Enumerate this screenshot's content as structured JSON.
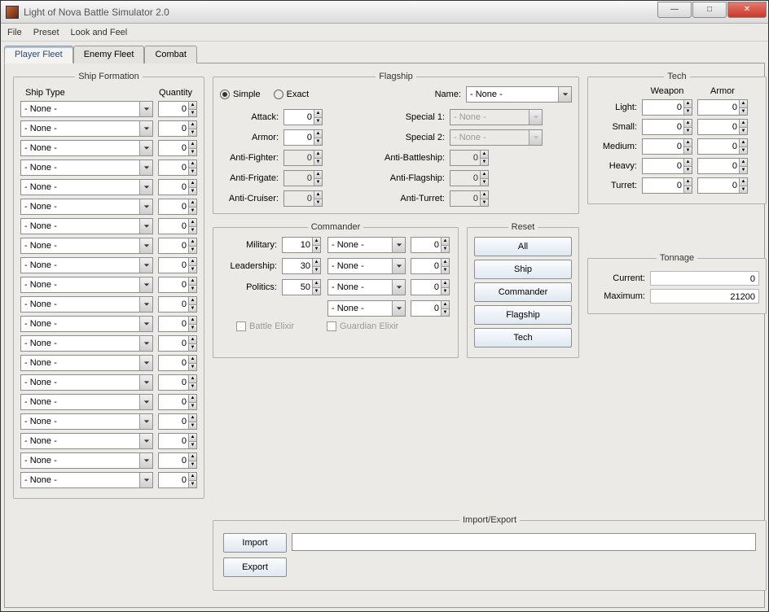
{
  "title": "Light of Nova Battle Simulator 2.0",
  "menu": {
    "file": "File",
    "preset": "Preset",
    "lookfeel": "Look and Feel"
  },
  "tabs": {
    "player": "Player Fleet",
    "enemy": "Enemy Fleet",
    "combat": "Combat"
  },
  "shipFormation": {
    "legend": "Ship Formation",
    "typeHeader": "Ship Type",
    "qtyHeader": "Quantity",
    "none": "- None -",
    "zero": "0",
    "rowCount": 20
  },
  "flagship": {
    "legend": "Flagship",
    "simple": "Simple",
    "exact": "Exact",
    "name": "Name:",
    "nameValue": "- None -",
    "attack": "Attack:",
    "armor": "Armor:",
    "antiFighter": "Anti-Fighter:",
    "antiFrigate": "Anti-Frigate:",
    "antiCruiser": "Anti-Cruiser:",
    "special1": "Special 1:",
    "special2": "Special 2:",
    "specialValue": "- None -",
    "antiBattleship": "Anti-Battleship:",
    "antiFlagship": "Anti-Flagship:",
    "antiTurret": "Anti-Turret:",
    "zero": "0"
  },
  "commander": {
    "legend": "Commander",
    "military": "Military:",
    "militaryVal": "10",
    "leadership": "Leadership:",
    "leadershipVal": "30",
    "politics": "Politics:",
    "politicsVal": "50",
    "none": "- None -",
    "zero": "0",
    "battleElixir": "Battle Elixir",
    "guardianElixir": "Guardian Elixir"
  },
  "reset": {
    "legend": "Reset",
    "all": "All",
    "ship": "Ship",
    "commander": "Commander",
    "flagship": "Flagship",
    "tech": "Tech"
  },
  "tech": {
    "legend": "Tech",
    "weapon": "Weapon",
    "armor": "Armor",
    "light": "Light:",
    "small": "Small:",
    "medium": "Medium:",
    "heavy": "Heavy:",
    "turret": "Turret:",
    "zero": "0"
  },
  "tonnage": {
    "legend": "Tonnage",
    "current": "Current:",
    "currentVal": "0",
    "maximum": "Maximum:",
    "maximumVal": "21200"
  },
  "importExport": {
    "legend": "Import/Export",
    "import": "Import",
    "export": "Export"
  }
}
